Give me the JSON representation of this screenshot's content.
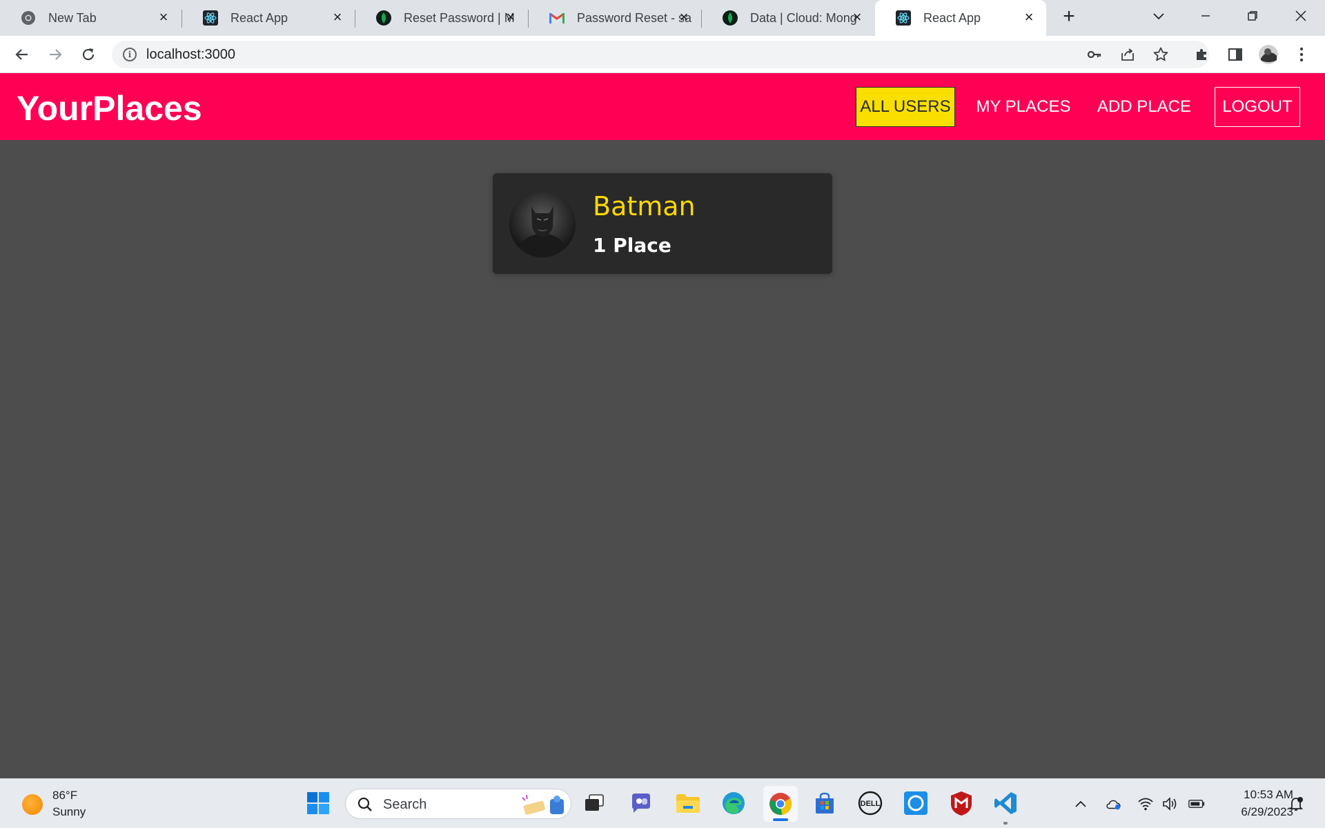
{
  "browser": {
    "tabs": [
      {
        "title": "New Tab",
        "icon": "chrome-icon"
      },
      {
        "title": "React App",
        "icon": "react-icon"
      },
      {
        "title": "Reset Password | M",
        "icon": "mongodb-leaf-icon"
      },
      {
        "title": "Password Reset - sa",
        "icon": "gmail-icon"
      },
      {
        "title": "Data | Cloud: Mong",
        "icon": "mongodb-leaf-icon"
      },
      {
        "title": "React App",
        "icon": "react-icon",
        "active": true
      }
    ],
    "url": "localhost:3000"
  },
  "app": {
    "brand": "YourPlaces",
    "nav": {
      "all_users": "ALL USERS",
      "my_places": "MY PLACES",
      "add_place": "ADD PLACE",
      "logout": "LOGOUT"
    },
    "colors": {
      "header": "#ff0055",
      "active_link": "#f8df00",
      "background": "#4d4d4d",
      "card": "#292929",
      "user_name": "#ffd900"
    }
  },
  "users": [
    {
      "name": "Batman",
      "places_label": "1 Place"
    }
  ],
  "taskbar": {
    "weather": {
      "temp": "86°F",
      "desc": "Sunny"
    },
    "search_label": "Search",
    "clock": {
      "time": "10:53 AM",
      "date": "6/29/2023"
    }
  }
}
